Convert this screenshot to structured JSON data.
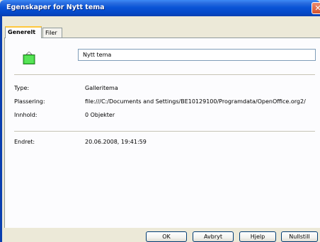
{
  "window": {
    "title": "Egenskaper for Nytt tema"
  },
  "tabs": [
    {
      "label": "Generelt",
      "active": true
    },
    {
      "label": "Filer",
      "active": false
    }
  ],
  "general": {
    "name_value": "Nytt tema",
    "fields": [
      {
        "label": "Type:",
        "value": "Galleritema"
      },
      {
        "label": "Plassering:",
        "value": "file:///C:/Documents and Settings/BE10129100/Programdata/OpenOffice.org2/"
      },
      {
        "label": "Innhold:",
        "value": "0 Objekter"
      },
      {
        "label": "Endret:",
        "value": "20.06.2008, 19:41:59"
      }
    ]
  },
  "buttons": {
    "ok": "OK",
    "cancel": "Avbryt",
    "help": "Hjelp",
    "reset": "Nullstill"
  },
  "colors": {
    "titlebar": "#0a54d6",
    "icon_fill": "#39d239",
    "tab_highlight": "#ffc73c"
  }
}
